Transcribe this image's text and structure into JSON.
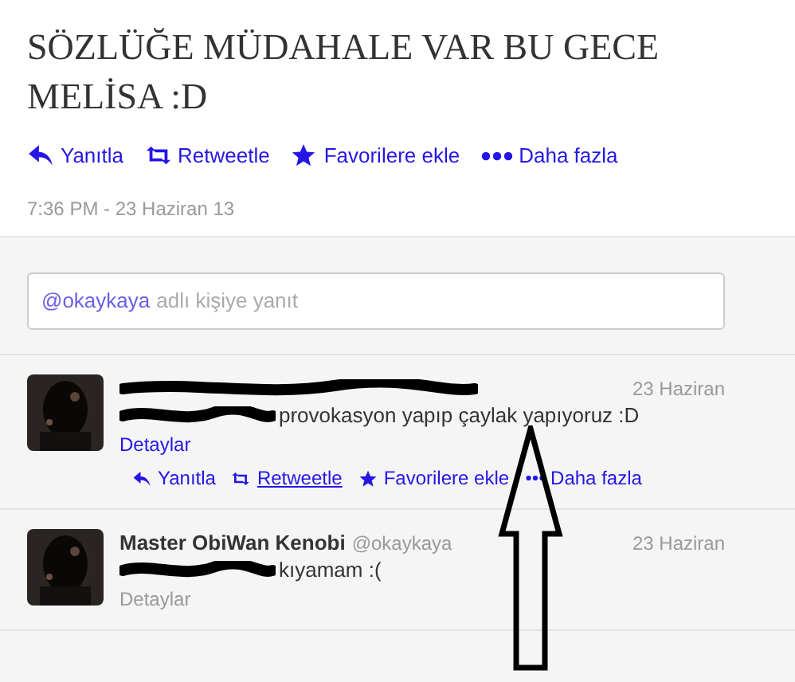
{
  "tweet": {
    "text": "SÖZLÜĞE MÜDAHALE VAR BU GECE MELİSA :D",
    "actions": [
      {
        "kind": "reply",
        "label": "Yanıtla"
      },
      {
        "kind": "retweet",
        "label": "Retweetle"
      },
      {
        "kind": "favorite",
        "label": "Favorilere ekle"
      },
      {
        "kind": "more",
        "label": "Daha fazla"
      }
    ],
    "timestamp": "7:36 PM - 23 Haziran 13"
  },
  "reply_box": {
    "mention": "@okaykaya",
    "placeholder": "adlı kişiye yanıt"
  },
  "replies": [
    {
      "name_redacted": true,
      "text": "provokasyon yapıp çaylak yapıyoruz :D",
      "date": "23 Haziran",
      "details": "Detaylar",
      "hovered": true,
      "actions": [
        {
          "kind": "reply",
          "label": "Yanıtla",
          "underlined": false
        },
        {
          "kind": "retweet",
          "label": "Retweetle",
          "underlined": true
        },
        {
          "kind": "favorite",
          "label": "Favorilere ekle",
          "underlined": false
        },
        {
          "kind": "more",
          "label": "Daha fazla",
          "underlined": false
        }
      ]
    },
    {
      "name_redacted": false,
      "name": "Master ObiWan Kenobi",
      "handle": "@okaykaya",
      "text": "kıyamam :(",
      "date": "23 Haziran",
      "details": "Detaylar",
      "hovered": false
    }
  ]
}
